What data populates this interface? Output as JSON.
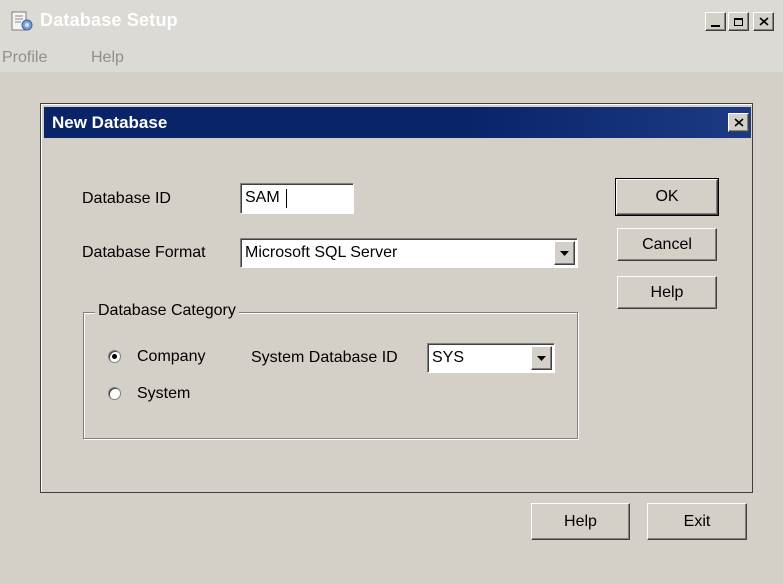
{
  "window": {
    "title": "Database Setup",
    "icons": {
      "app": "database-setup-icon",
      "minimize": "minimize-icon",
      "maximize": "maximize-icon",
      "close": "close-icon"
    }
  },
  "menu": {
    "items": [
      "Profile",
      "Help"
    ]
  },
  "dialog": {
    "title": "New Database",
    "close_icon": "close-icon",
    "database_id": {
      "label": "Database ID",
      "value": "SAM"
    },
    "database_format": {
      "label": "Database Format",
      "value": "Microsoft SQL Server"
    },
    "category": {
      "label": "Database Category",
      "options": [
        {
          "label": "Company",
          "selected": true
        },
        {
          "label": "System",
          "selected": false
        }
      ],
      "system_db": {
        "label": "System Database ID",
        "value": "SYS"
      }
    },
    "buttons": {
      "ok": "OK",
      "cancel": "Cancel",
      "help": "Help"
    }
  },
  "footer": {
    "help": "Help",
    "exit": "Exit"
  },
  "colors": {
    "dialog_title_bg": "#0a246a",
    "face": "#d4d0c8",
    "inactive_title_bg": "#dcdad4"
  }
}
